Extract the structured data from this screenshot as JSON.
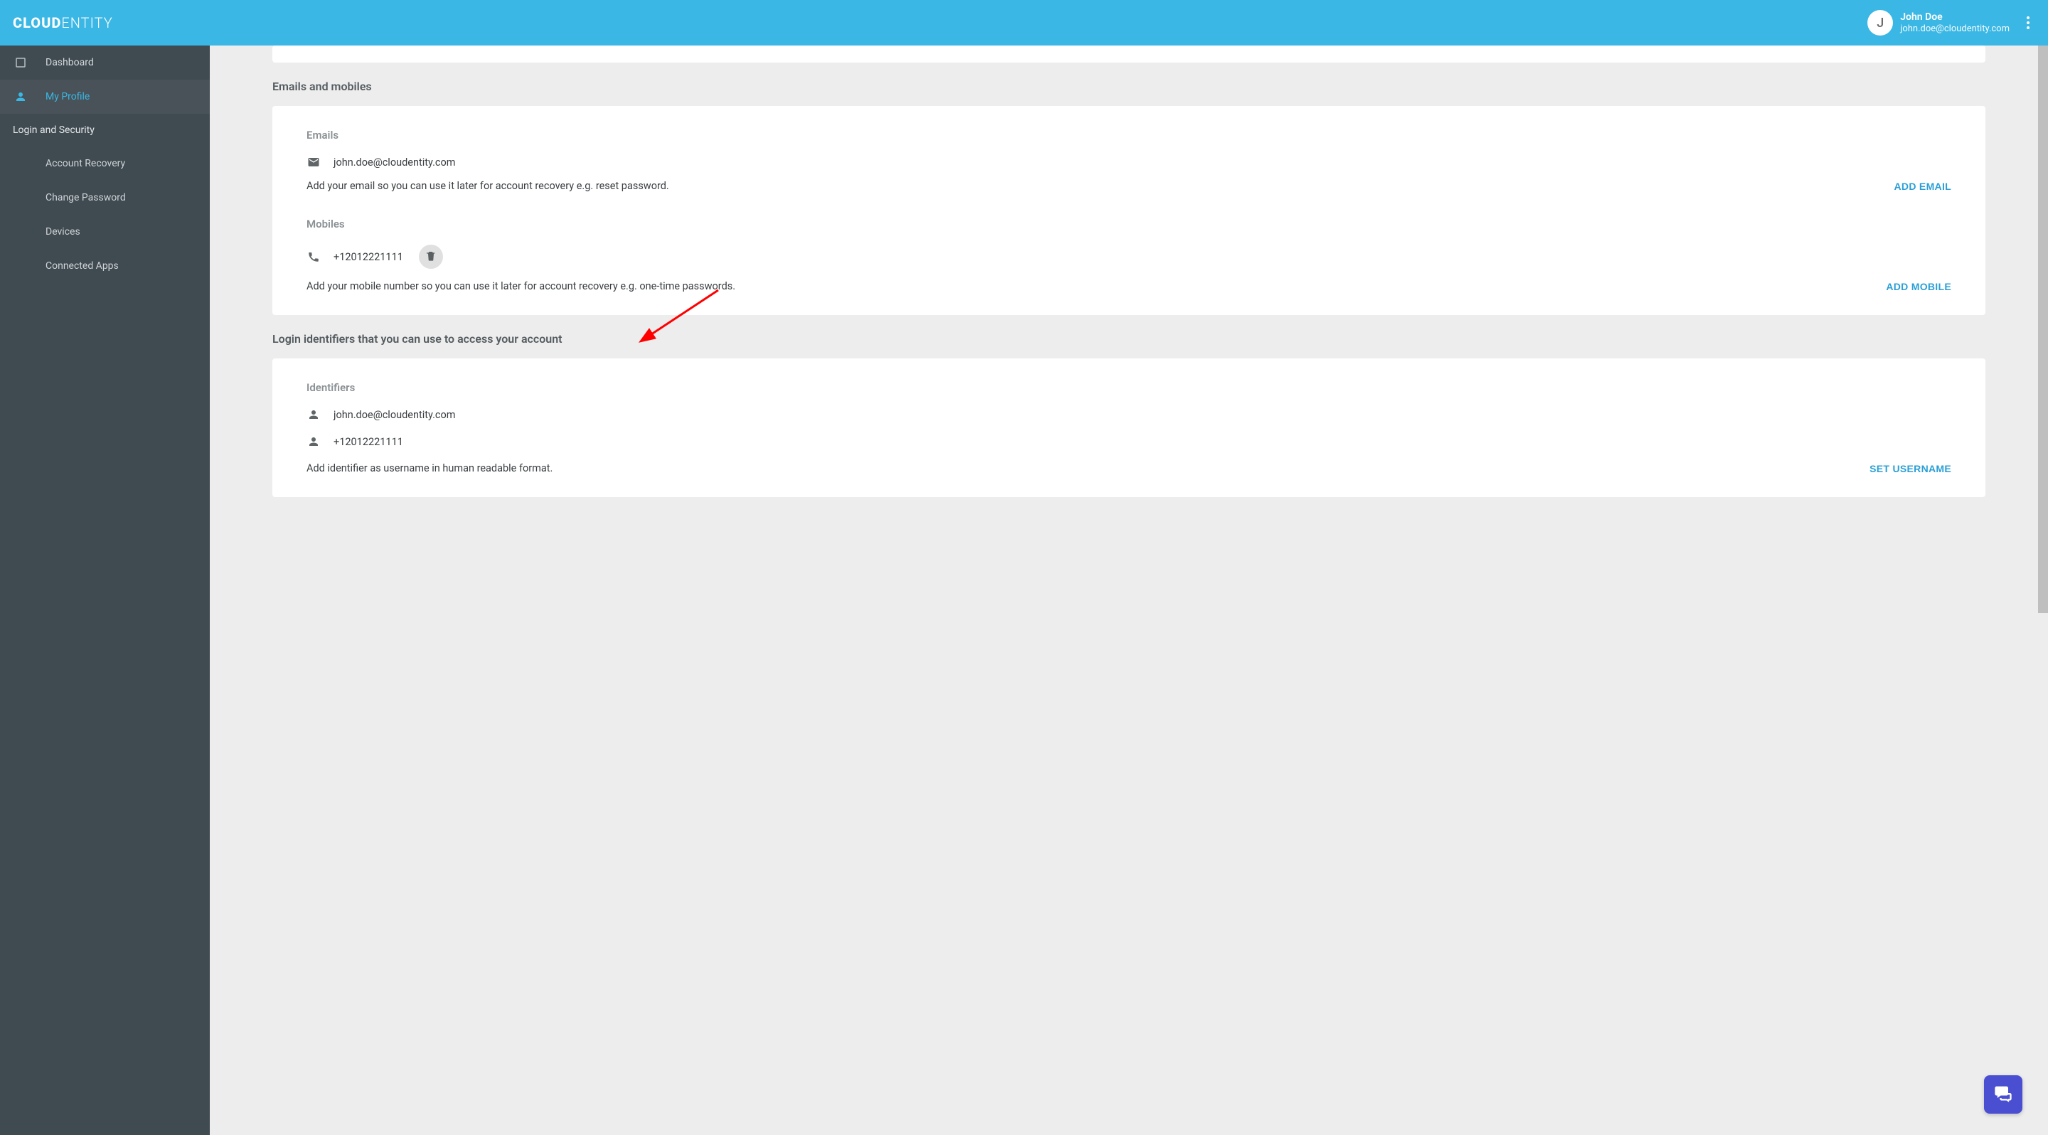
{
  "brand": {
    "bold": "CLOUD",
    "thin": "ENTITY"
  },
  "user": {
    "initial": "J",
    "name": "John Doe",
    "email": "john.doe@cloudentity.com"
  },
  "sidebar": {
    "dashboard": "Dashboard",
    "my_profile": "My Profile",
    "section_login_security": "Login and Security",
    "account_recovery": "Account Recovery",
    "change_password": "Change Password",
    "devices": "Devices",
    "connected_apps": "Connected Apps"
  },
  "sections": {
    "emails_mobiles_title": "Emails and mobiles",
    "emails_label": "Emails",
    "email_value": "john.doe@cloudentity.com",
    "email_helper": "Add your email so you can use it later for account recovery e.g. reset password.",
    "add_email": "ADD EMAIL",
    "mobiles_label": "Mobiles",
    "mobile_value": "+12012221111",
    "mobile_helper": "Add your mobile number so you can use it later for account recovery e.g. one-time passwords.",
    "add_mobile": "ADD MOBILE",
    "identifiers_title": "Login identifiers that you can use to access your account",
    "identifiers_label": "Identifiers",
    "identifier_email": "john.doe@cloudentity.com",
    "identifier_phone": "+12012221111",
    "identifier_helper": "Add identifier as username in human readable format.",
    "set_username": "SET USERNAME"
  }
}
